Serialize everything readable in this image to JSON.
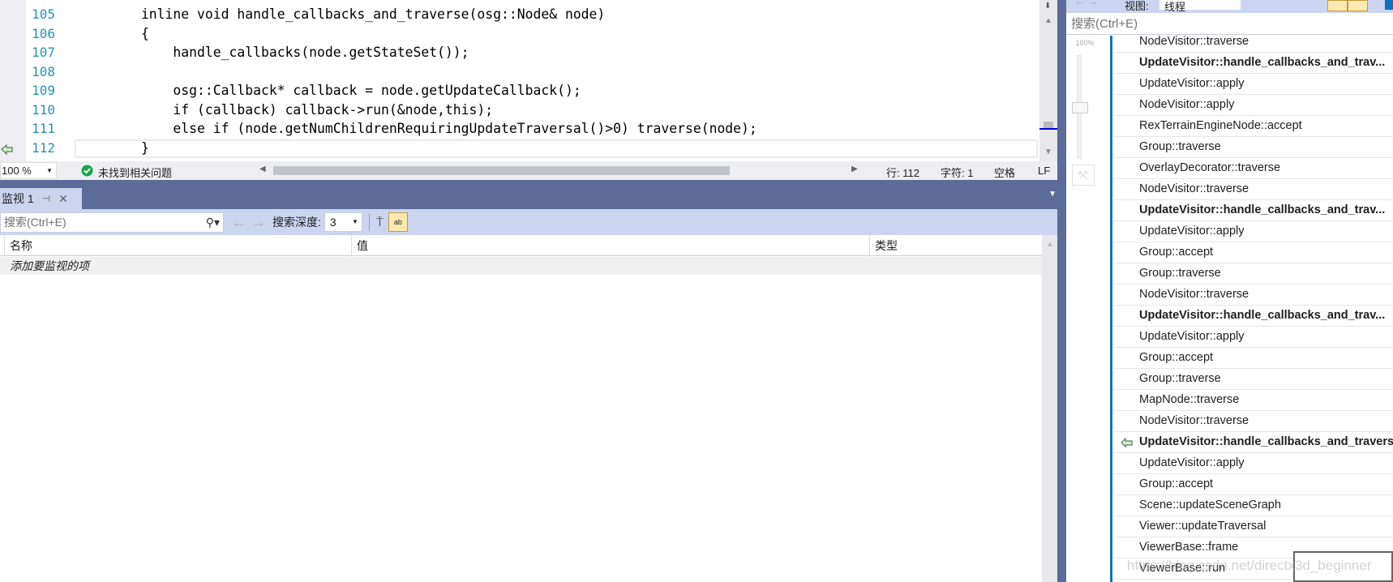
{
  "editor": {
    "lines": [
      {
        "num": "105",
        "code": "        inline void handle_callbacks_and_traverse(osg::Node& node)"
      },
      {
        "num": "106",
        "code": "        {"
      },
      {
        "num": "107",
        "code": "            handle_callbacks(node.getStateSet());"
      },
      {
        "num": "108",
        "code": ""
      },
      {
        "num": "109",
        "code": "            osg::Callback* callback = node.getUpdateCallback();"
      },
      {
        "num": "110",
        "code": "            if (callback) callback->run(&node,this);"
      },
      {
        "num": "111",
        "code": "            else if (node.getNumChildrenRequiringUpdateTraversal()>0) traverse(node);"
      },
      {
        "num": "112",
        "code": "        }"
      }
    ],
    "current_line_icon": "return-arrow-icon"
  },
  "status": {
    "zoom": "100 %",
    "issues": "未找到相关问题",
    "line": "行: 112",
    "char": "字符: 1",
    "spaces": "空格",
    "eol": "LF"
  },
  "watch": {
    "tab_label": "监视 1",
    "search_placeholder": "搜索(Ctrl+E)",
    "depth_label": "搜索深度:",
    "depth_value": "3",
    "columns": [
      "名称",
      "值",
      "类型"
    ],
    "add_item": "添加要监视的项"
  },
  "callstack": {
    "view_label": "视图:",
    "view_value": "线程",
    "search_placeholder": "搜索(Ctrl+E)",
    "zoom_label": "100%",
    "frames": [
      {
        "name": "NodeVisitor::traverse",
        "bold": false
      },
      {
        "name": "UpdateVisitor::handle_callbacks_and_trav...",
        "bold": true
      },
      {
        "name": "UpdateVisitor::apply",
        "bold": false
      },
      {
        "name": "NodeVisitor::apply",
        "bold": false
      },
      {
        "name": "RexTerrainEngineNode::accept",
        "bold": false
      },
      {
        "name": "Group::traverse",
        "bold": false
      },
      {
        "name": "OverlayDecorator::traverse",
        "bold": false
      },
      {
        "name": "NodeVisitor::traverse",
        "bold": false
      },
      {
        "name": "UpdateVisitor::handle_callbacks_and_trav...",
        "bold": true
      },
      {
        "name": "UpdateVisitor::apply",
        "bold": false
      },
      {
        "name": "Group::accept",
        "bold": false
      },
      {
        "name": "Group::traverse",
        "bold": false
      },
      {
        "name": "NodeVisitor::traverse",
        "bold": false
      },
      {
        "name": "UpdateVisitor::handle_callbacks_and_trav...",
        "bold": true
      },
      {
        "name": "UpdateVisitor::apply",
        "bold": false
      },
      {
        "name": "Group::accept",
        "bold": false
      },
      {
        "name": "Group::traverse",
        "bold": false
      },
      {
        "name": "MapNode::traverse",
        "bold": false
      },
      {
        "name": "NodeVisitor::traverse",
        "bold": false
      },
      {
        "name": "UpdateVisitor::handle_callbacks_and_travers",
        "bold": true,
        "current": true
      },
      {
        "name": "UpdateVisitor::apply",
        "bold": false
      },
      {
        "name": "Group::accept",
        "bold": false
      },
      {
        "name": "Scene::updateSceneGraph",
        "bold": false
      },
      {
        "name": "Viewer::updateTraversal",
        "bold": false
      },
      {
        "name": "ViewerBase::frame",
        "bold": false
      },
      {
        "name": "ViewerBase::run",
        "bold": false
      }
    ]
  },
  "watermark": "https://blog.csdn.net/directx3d_beginner",
  "colors": {
    "accent": "#0e70c0",
    "band": "#5d6b99",
    "toolbar": "#ccd5f0",
    "line_number": "#2b91af"
  }
}
